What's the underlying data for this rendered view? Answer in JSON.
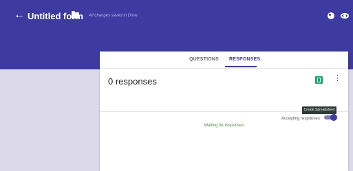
{
  "header": {
    "back_icon": "arrow-back-icon",
    "title": "Untitled form",
    "folder_icon": "folder-icon",
    "save_status": "All changes saved in Drive",
    "palette_icon": "palette-icon",
    "preview_icon": "eye-icon",
    "color": "#3d3aa1"
  },
  "tabs": [
    {
      "label": "QUESTIONS",
      "active": false
    },
    {
      "label": "RESPONSES",
      "active": true
    }
  ],
  "responses": {
    "count_text": "0 responses",
    "sheet_icon": "spreadsheet-icon",
    "more_icon": "more-vert-icon",
    "tooltip": "Create Spreadsheet",
    "accepting_label": "Accepting responses",
    "accepting_on": true,
    "waiting_text": "Waiting for responses"
  }
}
